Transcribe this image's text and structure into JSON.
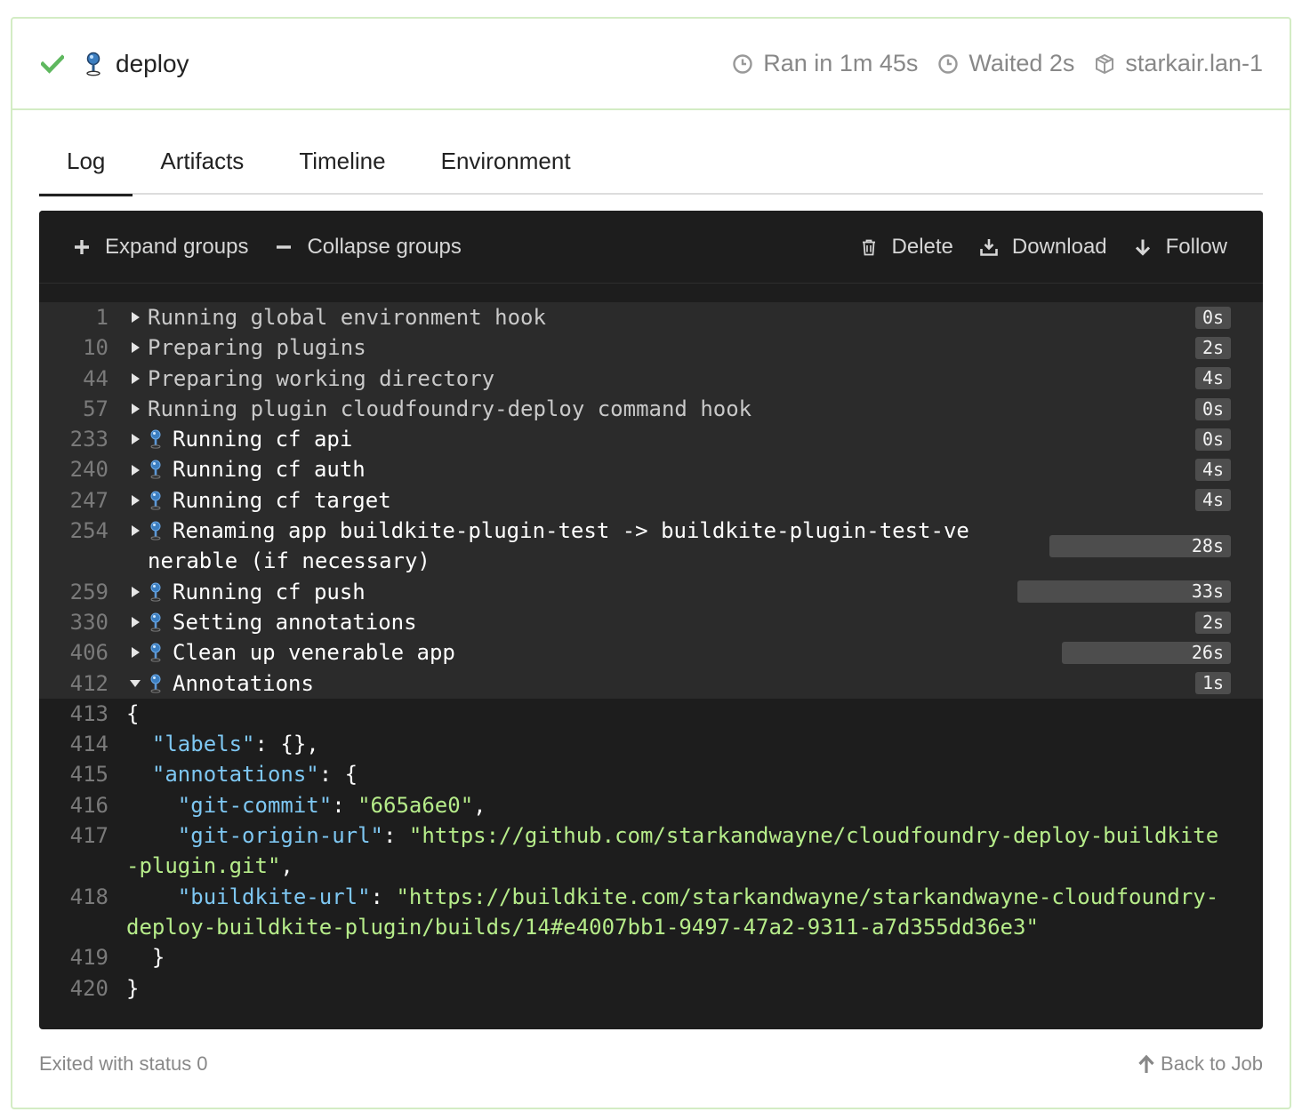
{
  "job": {
    "name": "deploy",
    "status_icon": "check-icon",
    "ran_in": "Ran in 1m 45s",
    "waited": "Waited 2s",
    "agent": "starkair.lan-1"
  },
  "tabs": [
    {
      "label": "Log",
      "active": true
    },
    {
      "label": "Artifacts",
      "active": false
    },
    {
      "label": "Timeline",
      "active": false
    },
    {
      "label": "Environment",
      "active": false
    }
  ],
  "toolbar": {
    "expand": "Expand groups",
    "collapse": "Collapse groups",
    "delete": "Delete",
    "download": "Download",
    "follow": "Follow"
  },
  "log_groups": [
    {
      "line": "1",
      "text": "Running global environment hook",
      "duration": "0s",
      "duration_fraction": 0.0,
      "pin": false
    },
    {
      "line": "10",
      "text": "Preparing plugins",
      "duration": "2s",
      "duration_fraction": 0.06,
      "pin": false
    },
    {
      "line": "44",
      "text": "Preparing working directory",
      "duration": "4s",
      "duration_fraction": 0.12,
      "pin": false
    },
    {
      "line": "57",
      "text": "Running plugin cloudfoundry-deploy command hook",
      "duration": "0s",
      "duration_fraction": 0.0,
      "pin": false
    },
    {
      "line": "233",
      "text": "Running cf api",
      "duration": "0s",
      "duration_fraction": 0.0,
      "pin": true
    },
    {
      "line": "240",
      "text": "Running cf auth",
      "duration": "4s",
      "duration_fraction": 0.12,
      "pin": true
    },
    {
      "line": "247",
      "text": "Running cf target",
      "duration": "4s",
      "duration_fraction": 0.12,
      "pin": true
    },
    {
      "line": "254",
      "text": "Renaming app buildkite-plugin-test -> buildkite-plugin-test-venerable (if necessary)",
      "duration": "28s",
      "duration_fraction": 0.85,
      "pin": true
    },
    {
      "line": "259",
      "text": "Running cf push",
      "duration": "33s",
      "duration_fraction": 1.0,
      "pin": true
    },
    {
      "line": "330",
      "text": "Setting annotations",
      "duration": "2s",
      "duration_fraction": 0.06,
      "pin": true
    },
    {
      "line": "406",
      "text": "Clean up venerable app",
      "duration": "26s",
      "duration_fraction": 0.79,
      "pin": true
    },
    {
      "line": "412",
      "text": "Annotations",
      "duration": "1s",
      "duration_fraction": 0.03,
      "pin": true,
      "expanded": true
    }
  ],
  "log_lines": [
    {
      "line": "413",
      "text": "{"
    },
    {
      "line": "414",
      "text": "  \"labels\": {},"
    },
    {
      "line": "415",
      "text": "  \"annotations\": {"
    },
    {
      "line": "416",
      "text": "    \"git-commit\": \"665a6e0\","
    },
    {
      "line": "417",
      "text": "    \"git-origin-url\": \"https://github.com/starkandwayne/cloudfoundry-deploy-buildkite-plugin.git\","
    },
    {
      "line": "418",
      "text": "    \"buildkite-url\": \"https://buildkite.com/starkandwayne/starkandwayne-cloudfoundry-deploy-buildkite-plugin/builds/14#e4007bb1-9497-47a2-9311-a7d355dd36e3\""
    },
    {
      "line": "419",
      "text": "  }"
    },
    {
      "line": "420",
      "text": "}"
    }
  ],
  "footer": {
    "exit_status": "Exited with status 0",
    "back": "Back to Job"
  },
  "colors": {
    "success": "#5fb85f",
    "card_border": "#d3ecc4",
    "log_bg": "#1d1d1d",
    "group_bg": "#2b2b2b",
    "json_key": "#7ec7f2",
    "json_string": "#b6ec8a"
  }
}
